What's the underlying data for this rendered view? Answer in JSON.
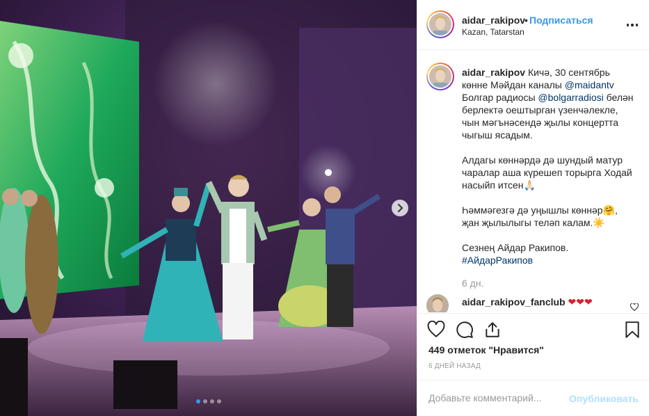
{
  "media": {
    "alt": "Concert stage with dancers in Tatar costumes",
    "carousel": {
      "count": 4,
      "active": 0
    }
  },
  "header": {
    "username": "aidar_rakipov",
    "separator": "•",
    "follow_label": "Подписаться",
    "location": "Kazan, Tatarstan"
  },
  "caption": {
    "username": "aidar_rakipov",
    "part1": " Кичә, 30 сентябрь\nкөнне Мәйдан каналы ",
    "mention1": "@maidantv",
    "part2": "\nБолгар радиосы ",
    "mention2": "@bolgarradiosi",
    "part3": " белән\nберлектә оештырган үзенчәлекле,\nчын мәгънәсендә җылы концертта\nчыгыш ясадым.\n\nАлдагы көннәрдә дә шундый матур\nчаралар аша күрешеп торырга Ходай\nнасыйп итсен🙏🏻\n\nҺәммәгезгә дә уңышлы көннәр🤗,\nҗан җылылыгы теләп калам.☀️\n\nСезнең Айдар Ракипов.\n",
    "hashtag": "#АйдарРакипов",
    "time": "6 дн."
  },
  "comment": {
    "username": "aidar_rakipov_fanclub",
    "text": " ❤❤❤"
  },
  "likes": "449 отметок \"Нравится\"",
  "date": "6 ДНЕЙ НАЗАД",
  "add_comment": {
    "placeholder": "Добавьте комментарий...",
    "publish_label": "Опубликовать"
  },
  "colors": {
    "link": "#3897f0",
    "publish_disabled": "#b2dffc",
    "muted": "#999999",
    "text": "#262626"
  }
}
